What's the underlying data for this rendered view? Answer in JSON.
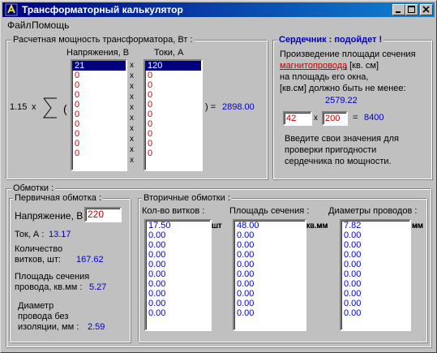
{
  "window": {
    "title": "Трансформаторный калькулятор"
  },
  "menu": [
    "Файл",
    "Помощь"
  ],
  "power_group": {
    "legend": "Расчетная мощность трансформатора, Вт :",
    "coef": "1.15",
    "x": "x",
    "paren_open": "(",
    "voltage_header": "Напряжения, В",
    "current_header": "Токи, А",
    "voltages": [
      "21",
      "0",
      "0",
      "0",
      "0",
      "0",
      "0",
      "0",
      "0",
      "0"
    ],
    "currents": [
      "120",
      "0",
      "0",
      "0",
      "0",
      "0",
      "0",
      "0",
      "0",
      "0"
    ],
    "mult_sign": "x",
    "result_prefix": ") =",
    "result": "2898.00"
  },
  "core_group": {
    "status": "Сердечник : подойдет !",
    "line1": "Произведение площади сечения",
    "link": "магнитопровода",
    "line2_suffix": ", [кв. см]",
    "line3": "на площадь его окна,",
    "line4": "[кв.см] должно быть не менее:",
    "min_value": "2579.22",
    "input_a": "42",
    "input_b": "200",
    "x": "x",
    "eq": "=",
    "product": "8400",
    "hint1": "Введите свои значения для",
    "hint2": "проверки пригодности",
    "hint3": "сердечника по мощности."
  },
  "windings": {
    "legend": "Обмотки :",
    "primary": {
      "legend": "Первичная обмотка :",
      "voltage_label": "Напряжение, В :",
      "voltage_value": "220",
      "current_label": "Ток, А :",
      "current_value": "13.17",
      "turns_label1": "Количество",
      "turns_label2": "витков, шт:",
      "turns_value": "167.62",
      "area_label1": "Площадь сечения",
      "area_label2": "провода, кв.мм :",
      "area_value": "5.27",
      "diam_label1": "Диаметр",
      "diam_label2": "провода без",
      "diam_label3": "изоляции, мм :",
      "diam_value": "2.59"
    },
    "secondary": {
      "legend": "Вторичные обмотки :",
      "turns_header": "Кол-во витков :",
      "area_header": "Площадь сечения :",
      "diam_header": "Диаметры проводов :",
      "turns": [
        "17.50",
        "0.00",
        "0.00",
        "0.00",
        "0.00",
        "0.00",
        "0.00",
        "0.00",
        "0.00",
        "0.00"
      ],
      "areas": [
        "48.00",
        "0.00",
        "0.00",
        "0.00",
        "0.00",
        "0.00",
        "0.00",
        "0.00",
        "0.00",
        "0.00"
      ],
      "diams": [
        "7.82",
        "0.00",
        "0.00",
        "0.00",
        "0.00",
        "0.00",
        "0.00",
        "0.00",
        "0.00",
        "0.00"
      ],
      "unit_pcs": "шт",
      "unit_sqmm": "кв.мм",
      "unit_mm": "мм"
    }
  }
}
